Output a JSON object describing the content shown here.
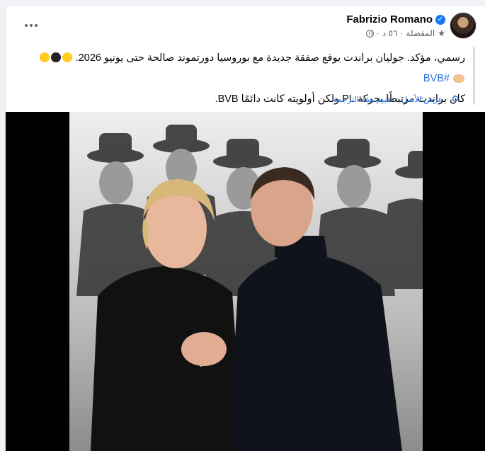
{
  "post": {
    "author": "Fabrizio Romano",
    "timestamp": "٥٦ د",
    "favorites_label": "المفضلة",
    "separator": "·",
    "text_line1_main": "رسمي، مؤكد. جوليان براندت يوقع صفقة جديدة مع بوروسيا دورتموند صالحة حتى يونيو 2026.",
    "hashtag": "#BVB",
    "text_line2": "كان براندت مرتبطًا بحركة PL ولكن أولويته كانت دائمًا BVB.",
    "see_original": "عرض الأصل",
    "rate_translation": "تقييم هذه الترجمة",
    "dot": "·"
  },
  "icons": {
    "more": "more-horizontal-icon",
    "verified": "verified-badge-icon",
    "globe": "globe-icon",
    "star": "star-icon",
    "gear": "settings-gear-icon"
  },
  "colors": {
    "link": "#216fdb",
    "verified": "#1877f2",
    "meta": "#65676b"
  }
}
